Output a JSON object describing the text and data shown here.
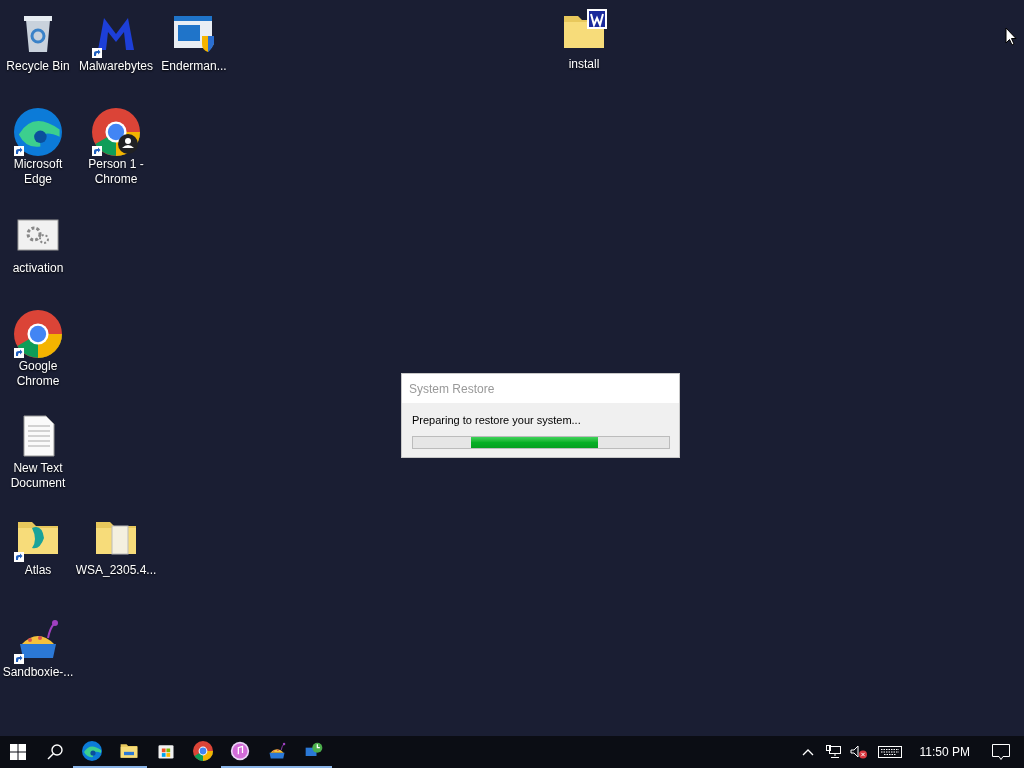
{
  "desktop_icons": [
    {
      "label": "Recycle Bin",
      "kind": "recycle",
      "shortcut": false
    },
    {
      "label": "Malwarebytes",
      "kind": "malware",
      "shortcut": true
    },
    {
      "label": "Enderman...",
      "kind": "window-shield",
      "shortcut": false
    },
    {
      "label": "install",
      "kind": "folder-w",
      "shortcut": false
    },
    {
      "label": "Microsoft Edge",
      "kind": "edge",
      "shortcut": true
    },
    {
      "label": "Person 1 - Chrome",
      "kind": "chrome-person",
      "shortcut": true
    },
    {
      "label": "activation",
      "kind": "gear-window",
      "shortcut": false
    },
    {
      "label": "Google Chrome",
      "kind": "chrome",
      "shortcut": true
    },
    {
      "label": "New Text Document",
      "kind": "text",
      "shortcut": false
    },
    {
      "label": "Atlas",
      "kind": "folder-atlas",
      "shortcut": true
    },
    {
      "label": "WSA_2305.4...",
      "kind": "folder-zip",
      "shortcut": false
    },
    {
      "label": "Sandboxie-...",
      "kind": "sandbox",
      "shortcut": true
    }
  ],
  "dialog": {
    "title": "System Restore",
    "message": "Preparing to restore your system...",
    "progress": {
      "kind": "marquee"
    }
  },
  "taskbar": {
    "apps": [
      {
        "kind": "edge",
        "running": true
      },
      {
        "kind": "explorer",
        "running": true
      },
      {
        "kind": "store",
        "running": false
      },
      {
        "kind": "chrome",
        "running": false
      },
      {
        "kind": "music",
        "running": true
      },
      {
        "kind": "sandbox",
        "running": true
      },
      {
        "kind": "network-app",
        "running": true
      }
    ],
    "clock": "11:50 PM"
  }
}
